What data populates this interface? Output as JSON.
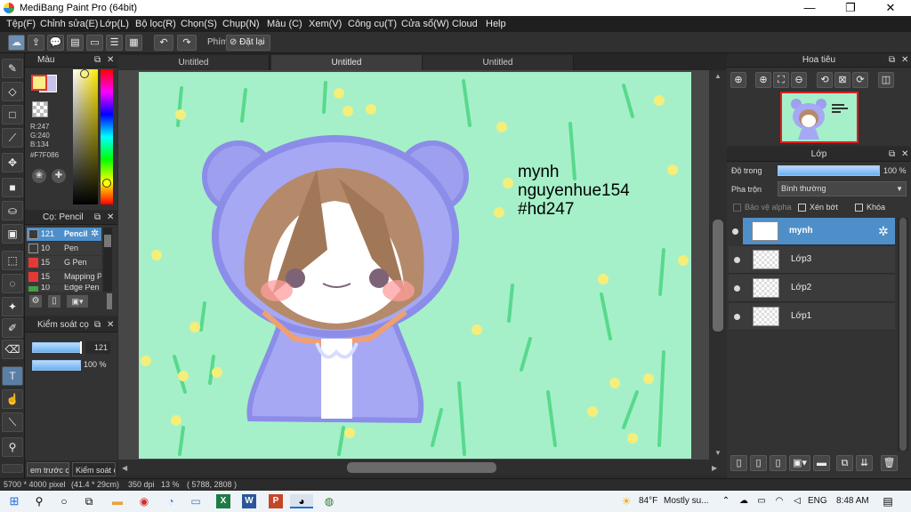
{
  "window": {
    "title": "MediBang Paint Pro (64bit)",
    "minimize": "—",
    "maximize": "❐",
    "close": "✕"
  },
  "menu": [
    "Tệp(F)",
    "Chỉnh sửa(E)",
    "Lớp(L)",
    "Bộ lọc(R)",
    "Chọn(S)",
    "Chụp(N)",
    "Màu (C)",
    "Xem(V)",
    "Công cụ(T)",
    "Cửa sổ(W)",
    "Cloud",
    "Help"
  ],
  "toolbar": {
    "phim_label": "Phím",
    "reset_label": "Đặt lại"
  },
  "color_panel": {
    "title": "Màu",
    "r": "R:247",
    "g": "G:240",
    "b": "B:134",
    "hex": "#F7F086",
    "fg_color": "#F7F086",
    "bg_color": "#c9c2ea"
  },
  "brush_panel": {
    "title": "Cọ: Pencil",
    "items": [
      {
        "size": "121",
        "name": "Pencil",
        "color": "#3a3a3a",
        "selected": true
      },
      {
        "size": "10",
        "name": "Pen",
        "color": "#3a3a3a"
      },
      {
        "size": "15",
        "name": "G Pen",
        "color": "#e53935"
      },
      {
        "size": "15",
        "name": "Mapping P",
        "color": "#e53935"
      },
      {
        "size": "10",
        "name": "Edge Pen",
        "color": "#43a047"
      }
    ]
  },
  "brush_control": {
    "title": "Kiểm soát cọ",
    "size_value": "121",
    "opacity_value": "100 %"
  },
  "bottom_tabs": [
    "em trước cọ",
    "Kiểm soát cọ"
  ],
  "doc_tabs": [
    "Untitled",
    "Untitled",
    "Untitled"
  ],
  "canvas": {
    "text_lines": [
      "mynh",
      "nguyenhue154",
      "#hd247"
    ]
  },
  "navigator": {
    "title": "Hoa tiêu"
  },
  "layer_panel": {
    "title": "Lớp",
    "opacity_label": "Độ trong",
    "opacity_value": "100 %",
    "blend_label": "Pha trộn",
    "blend_value": "Bình thường",
    "protect_alpha": "Bảo vệ alpha",
    "clipping": "Xén bớt",
    "lock": "Khóa",
    "layers": [
      {
        "name": "mynh",
        "selected": true
      },
      {
        "name": "Lớp3"
      },
      {
        "name": "Lớp2"
      },
      {
        "name": "Lớp1"
      }
    ]
  },
  "status": {
    "size": "5700 * 4000 pixel",
    "cm": "(41.4 * 29cm)",
    "dpi": "350 dpi",
    "zoom": "13 %",
    "coords": "( 5788, 2808 )"
  },
  "taskbar": {
    "weather_temp": "84°F",
    "weather_text": "Mostly su...",
    "lang": "ENG",
    "time": "8:48 AM"
  }
}
